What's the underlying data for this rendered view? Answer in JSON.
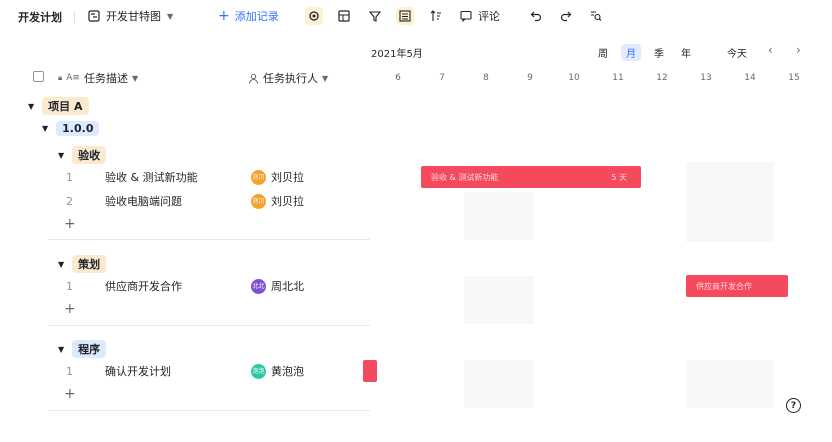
{
  "toolbar": {
    "title": "开发计划",
    "view_name": "开发甘特图",
    "add_record": "添加记录",
    "comment": "评论"
  },
  "columns": {
    "desc": "任务描述",
    "owner": "任务执行人"
  },
  "groups": {
    "project": "项目 A",
    "version": "1.0.0",
    "g1": {
      "label": "验收",
      "rows": [
        {
          "idx": "1",
          "name": "验收 & 测试新功能",
          "owner": "刘贝拉",
          "avatar_color": "#f5a12d",
          "avatar_text": "刘贝"
        },
        {
          "idx": "2",
          "name": "验收电脑端问题",
          "owner": "刘贝拉",
          "avatar_color": "#f5a12d",
          "avatar_text": "刘贝"
        }
      ]
    },
    "g2": {
      "label": "策划",
      "rows": [
        {
          "idx": "1",
          "name": "供应商开发合作",
          "owner": "周北北",
          "avatar_color": "#7b4fd6",
          "avatar_text": "北北"
        }
      ]
    },
    "g3": {
      "label": "程序",
      "rows": [
        {
          "idx": "1",
          "name": "确认开发计划",
          "owner": "黄泡泡",
          "avatar_color": "#2ec7a6",
          "avatar_text": "泡泡"
        }
      ]
    }
  },
  "gantt": {
    "month": "2021年5月",
    "scales": [
      "周",
      "月",
      "季",
      "年"
    ],
    "active_scale": "月",
    "today": "今天",
    "days": [
      "6",
      "7",
      "8",
      "9",
      "10",
      "11",
      "12",
      "13",
      "14",
      "15"
    ],
    "bars": [
      {
        "label": "验收 & 测试新功能",
        "duration": "5 天"
      },
      {
        "label": "供应商开发合作",
        "duration": ""
      },
      {
        "label": "",
        "duration": ""
      }
    ],
    "bar_color": "#f54a5e"
  },
  "icons": {
    "settings": "gear-icon",
    "table": "table-icon",
    "filter": "filter-icon",
    "group": "group-icon",
    "sort": "sort-icon",
    "comment": "comment-icon",
    "undo": "undo-icon",
    "redo": "redo-icon",
    "search": "search-icon",
    "help": "help-icon"
  }
}
